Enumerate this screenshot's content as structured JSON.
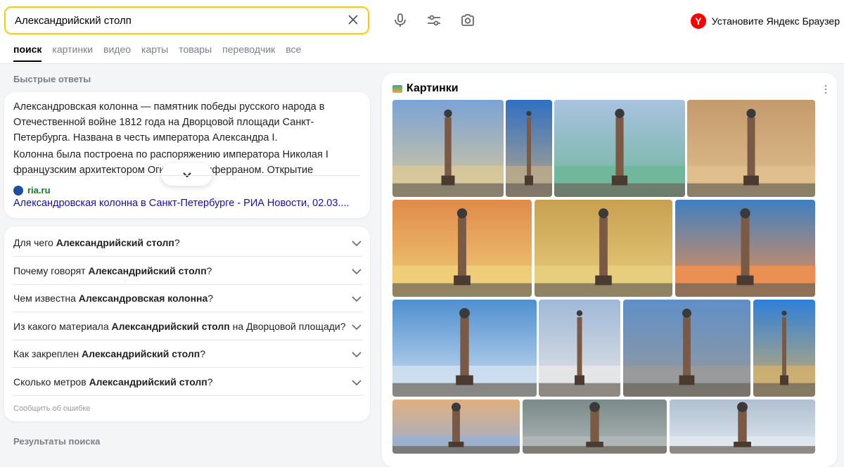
{
  "search": {
    "query": "Александрийский столп"
  },
  "promo": {
    "text": "Установите Яндекс Браузер",
    "logo": "Y"
  },
  "tabs": [
    "поиск",
    "картинки",
    "видео",
    "карты",
    "товары",
    "переводчик",
    "все"
  ],
  "quick_answers": {
    "title": "Быстрые ответы",
    "paragraph1": "Александровская колонна — памятник победы русского народа в Отечественной войне 1812 года на Дворцовой площади Санкт-Петербурга. Названа в честь императора Александра I.",
    "paragraph2": "Колонна была построена по распоряжению императора Николая I французским архитектором Огюстом Монферраном. Открытие",
    "source_domain": "ria.ru",
    "source_title": "Александровская колонна в Санкт-Петербурге - РИА Новости, 02.03...."
  },
  "faq": {
    "items": [
      {
        "pre": "Для чего ",
        "bold": "Александрийский столп",
        "post": "?"
      },
      {
        "pre": "Почему говорят ",
        "bold": "Александрийский столп",
        "post": "?"
      },
      {
        "pre": "Чем известна ",
        "bold": "Александровская колонна",
        "post": "?"
      },
      {
        "pre": "Из какого материала ",
        "bold": "Александрийский столп",
        "post": " на Дворцовой площади?"
      },
      {
        "pre": "Как закреплен ",
        "bold": "Александрийский столп",
        "post": "?"
      },
      {
        "pre": "Сколько метров ",
        "bold": "Александрийский столп",
        "post": "?"
      }
    ],
    "report": "Сообщить об ошибке"
  },
  "results_title": "Результаты поиска",
  "images": {
    "title": "Картинки"
  },
  "colors": {
    "accent": "#ffcc00",
    "link": "#1a0dab",
    "source": "#0f7b23",
    "brand_red": "#ff0000"
  }
}
